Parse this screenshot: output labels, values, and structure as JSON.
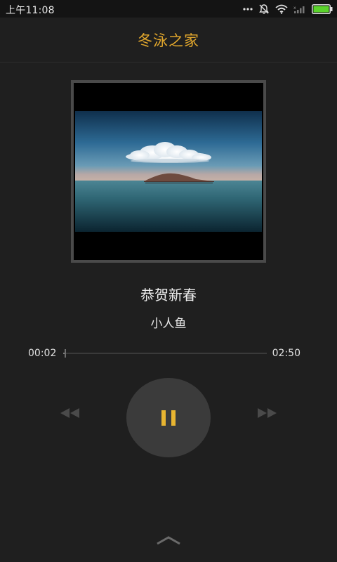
{
  "status_bar": {
    "time": "上午11:08",
    "icons": [
      "more-dots-icon",
      "notifications-off-icon",
      "wifi-icon",
      "signal-icon",
      "battery-icon"
    ],
    "battery_color": "#5bd32c"
  },
  "header": {
    "title": "冬泳之家",
    "title_color": "#e2a72c"
  },
  "player": {
    "album_art": "album-cover-image",
    "song_title": "恭贺新春",
    "artist": "小人鱼",
    "current_time": "00:02",
    "total_time": "02:50",
    "progress": 0.012,
    "state": "playing",
    "controls": {
      "previous": "rewind-icon",
      "play_pause": "pause-icon",
      "next": "fast-forward-icon",
      "expand": "chevron-up-icon"
    },
    "accent_color": "#e8b531"
  }
}
